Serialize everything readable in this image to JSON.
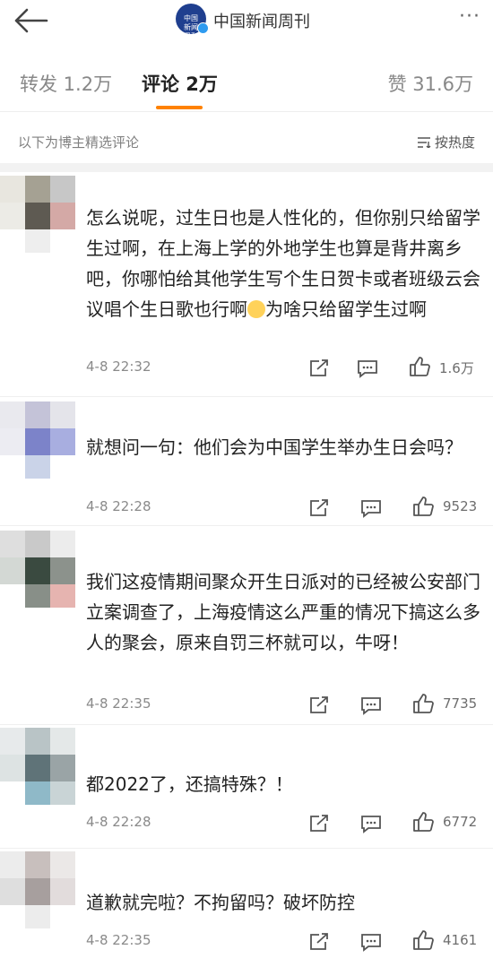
{
  "header": {
    "title": "中国新闻周刊",
    "logo_text": "中国新闻周刊"
  },
  "tabs": [
    {
      "label": "转发 1.2万"
    },
    {
      "label": "评论 2万"
    },
    {
      "label": "赞 31.6万"
    }
  ],
  "filter": {
    "hint": "以下为博主精选评论",
    "sort_label": "按热度"
  },
  "comments": [
    {
      "text": "怎么说呢，过生日也是人性化的，但你别只给留学生过啊，在上海上学的外地学生也算是背井离乡吧，你哪怕给其他学生写个生日贺卡或者班级云会议唱个生日歌也行啊",
      "text_after_emoji": "为啥只给留学生过啊",
      "time": "4-8 22:32",
      "likes": "1.6万"
    },
    {
      "text": "就想问一句：他们会为中国学生举办生日会吗？",
      "time": "4-8 22:28",
      "likes": "9523"
    },
    {
      "text": "我们这疫情期间聚众开生日派对的已经被公安部门立案调查了，上海疫情这么严重的情况下搞这么多人的聚会，原来自罚三杯就可以，牛呀！",
      "time": "4-8 22:35",
      "likes": "7735"
    },
    {
      "text": "都2022了，还搞特殊？！",
      "time": "4-8 22:28",
      "likes": "6772"
    },
    {
      "text": "道歉就完啦？不拘留吗？破坏防控",
      "time": "4-8 22:35",
      "likes": "4161"
    }
  ],
  "colors": {
    "accent": "#ff8200",
    "brand": "#1f3f8f",
    "verify": "#2e9bf0"
  },
  "icons": [
    "back-arrow-icon",
    "more-dots-icon",
    "sort-icon",
    "share-icon",
    "comment-icon",
    "like-icon",
    "smile-emoji-icon"
  ]
}
